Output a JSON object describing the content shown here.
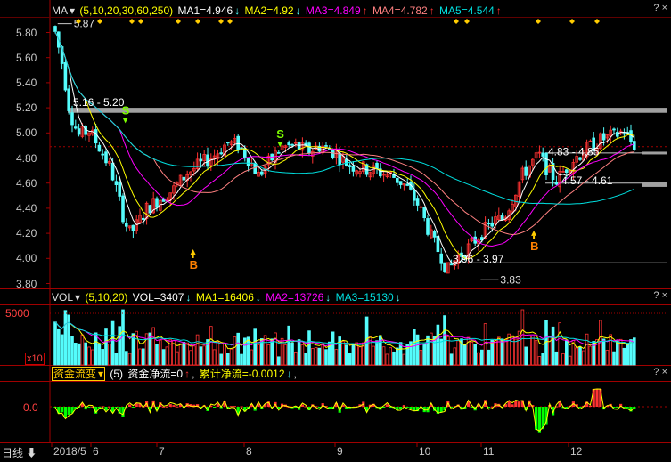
{
  "price_legend": {
    "indicator": "MA",
    "params": "(5,10,20,30,60,250)",
    "ma1": "MA1=4.946",
    "ma2": "MA2=4.92",
    "ma3": "MA3=4.849",
    "ma4": "MA4=4.782",
    "ma5": "MA5=4.544"
  },
  "vol_legend": {
    "indicator": "VOL",
    "params": "(5,10,20)",
    "vol": "VOL=3407",
    "ma1": "MA1=16406",
    "ma2": "MA2=13726",
    "ma3": "MA3=15130"
  },
  "flow_legend": {
    "indicator": "资金流变",
    "param": "(5)",
    "net": "资金净流=0",
    "cum": "累计净流=-0.0012"
  },
  "corner_buttons": [
    "?",
    "×"
  ],
  "period_label": "日线",
  "price_axis": [
    "5.80",
    "5.60",
    "5.40",
    "5.20",
    "5.00",
    "4.80",
    "4.60",
    "4.40",
    "4.20",
    "4.00",
    "3.80"
  ],
  "vol_axis": {
    "top": "5000",
    "unit": "x10"
  },
  "flow_axis": [
    "0.0"
  ],
  "x_labels": [
    "2018/5",
    "6",
    "7",
    "8",
    "9",
    "10",
    "11",
    "12"
  ],
  "annotations": {
    "high_label": "5.87",
    "low_label": "3.83",
    "band1": "5.16 - 5.20",
    "band2": "4.83 - 4.85",
    "band3": "4.57 - 4.61",
    "band4": "3.96 - 3.97",
    "signals": [
      {
        "text": "S",
        "kind": "sell",
        "x_date": "2018-05-31",
        "price": 5.12
      },
      {
        "text": "B",
        "kind": "buy",
        "x_date": "2018-06-28",
        "price": 4.13
      },
      {
        "text": "S",
        "kind": "sell",
        "x_date": "2018-08-03",
        "price": 4.93
      },
      {
        "text": "B",
        "kind": "buy",
        "x_date": "2018-11-16",
        "price": 4.28
      }
    ]
  },
  "colors": {
    "up": "#ff3232",
    "down": "#54fcfc",
    "ma1": "#ffffff",
    "ma2": "#ffff00",
    "ma3": "#ff00ff",
    "ma4": "#ff8080",
    "ma5": "#00e0e0",
    "flow_line": "#ffff00",
    "flow_up": "#ff3232",
    "flow_down": "#00ff00",
    "grid": "#800000",
    "band": "#a0a0a0",
    "diamond": "#ffcc00"
  },
  "chart_data": {
    "type": "candlestick",
    "ylim": [
      3.8,
      5.9
    ],
    "series": [
      {
        "name": "MA1",
        "x": [
          "2018-05-02",
          "2018-05-20",
          "2018-06-05",
          "2018-06-25",
          "2018-07-15",
          "2018-08-05",
          "2018-08-25",
          "2018-09-15",
          "2018-10-05",
          "2018-10-25",
          "2018-11-10",
          "2018-11-30",
          "2018-12-15",
          "2018-12-28"
        ],
        "values": [
          5.78,
          5.05,
          4.78,
          4.22,
          4.55,
          4.88,
          4.88,
          4.85,
          4.6,
          4.02,
          4.32,
          4.66,
          4.98,
          4.95
        ]
      },
      {
        "name": "MA5",
        "x": [
          "2018-05-02",
          "2018-06-05",
          "2018-07-15",
          "2018-08-25",
          "2018-09-15",
          "2018-10-25",
          "2018-11-30",
          "2018-12-28"
        ],
        "values": [
          5.7,
          5.3,
          4.78,
          4.73,
          4.72,
          4.53,
          4.49,
          4.544
        ]
      }
    ],
    "high": {
      "date": "2018-05-03",
      "price": 5.87
    },
    "low": {
      "date": "2018-10-25",
      "price": 3.83
    }
  }
}
